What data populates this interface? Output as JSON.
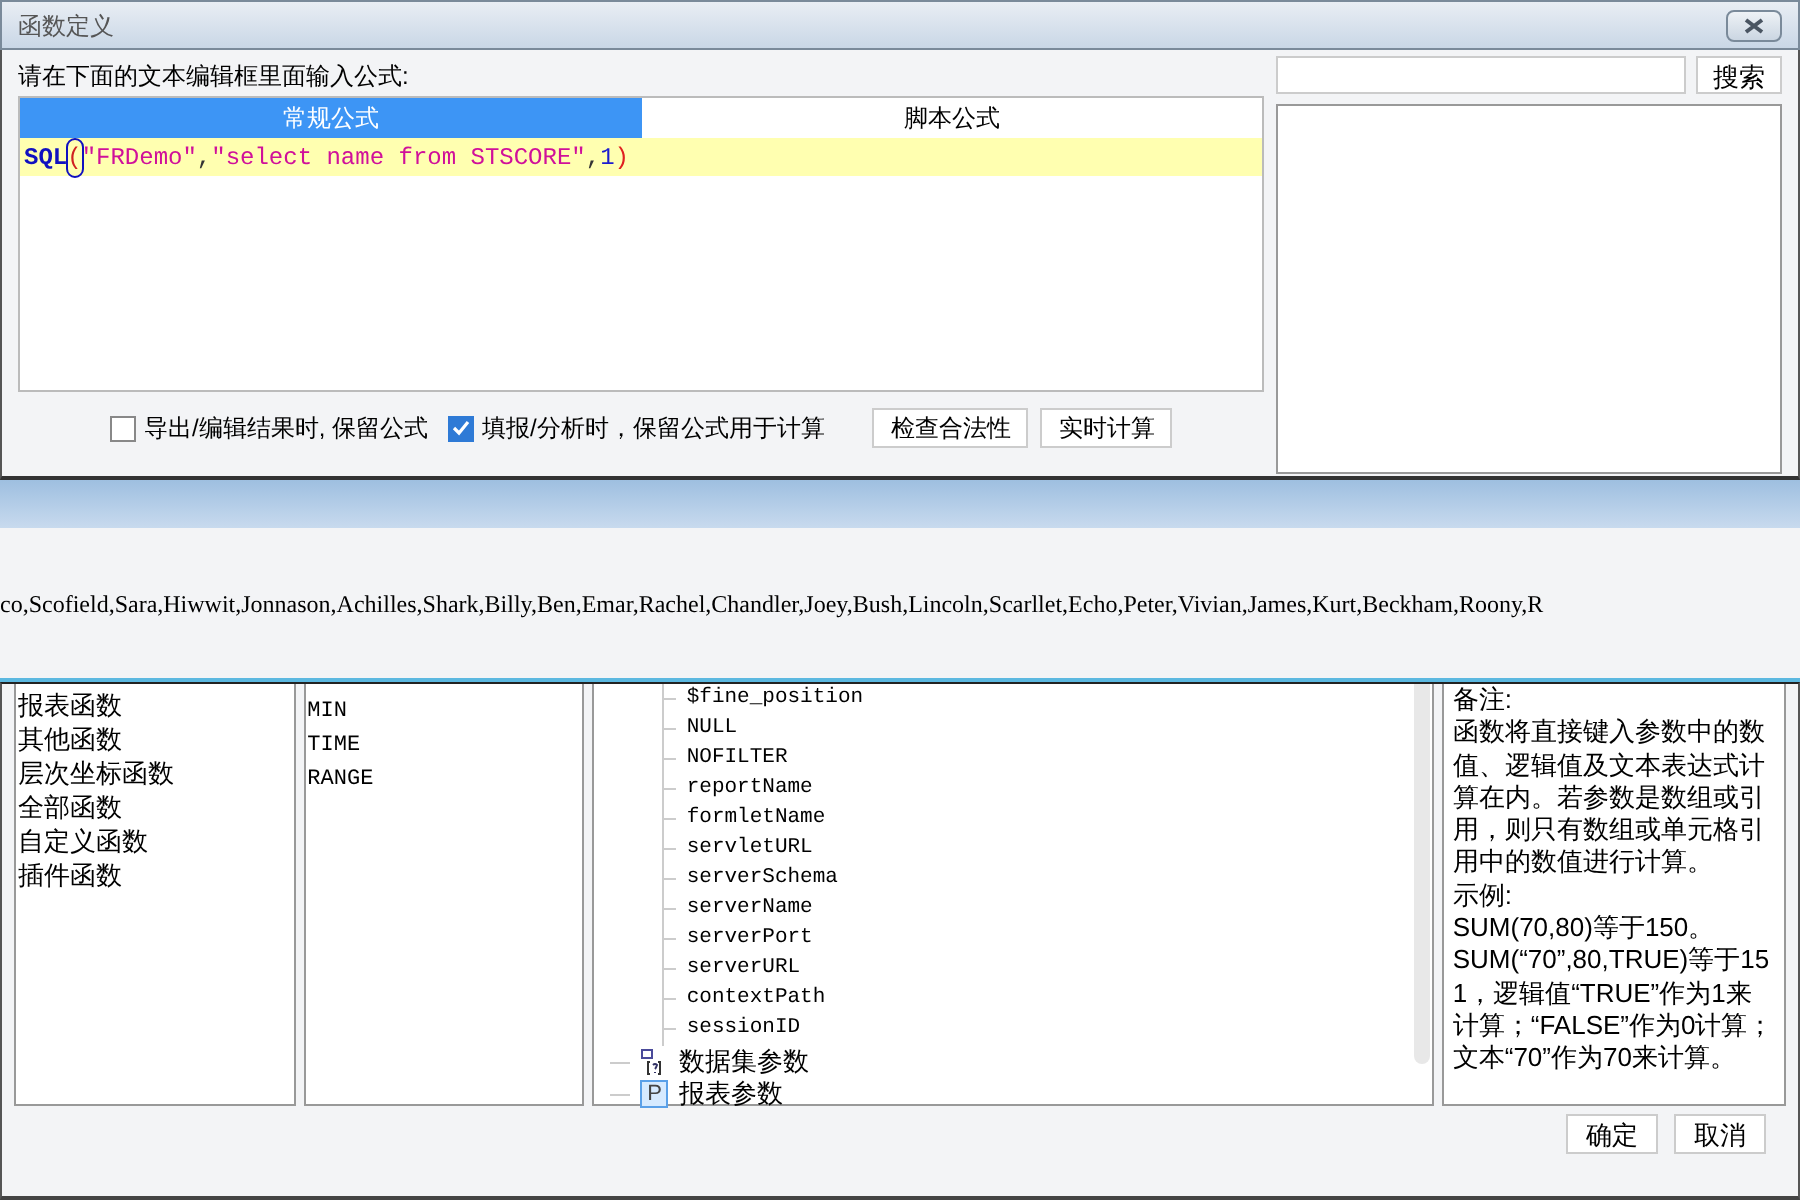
{
  "window": {
    "title": "函数定义"
  },
  "prompt": "请在下面的文本编辑框里面输入公式:",
  "search": {
    "button": "搜索"
  },
  "tabs": [
    {
      "label": "常规公式",
      "selected": true
    },
    {
      "label": "脚本公式",
      "selected": false
    }
  ],
  "formula": [
    {
      "kind": "function",
      "text": "SQL"
    },
    {
      "kind": "bracket",
      "text": "(",
      "highlighted": true
    },
    {
      "kind": "string",
      "text": "\"FRDemo\""
    },
    {
      "kind": "punct",
      "text": ","
    },
    {
      "kind": "string",
      "text": "\"select name from STSCORE\""
    },
    {
      "kind": "punct",
      "text": ","
    },
    {
      "kind": "number",
      "text": "1"
    },
    {
      "kind": "bracket",
      "text": ")",
      "highlighted": false
    }
  ],
  "options": [
    {
      "label": "导出/编辑结果时, 保留公式",
      "checked": false
    },
    {
      "label": "填报/分析时，保留公式用于计算",
      "checked": true
    }
  ],
  "actions": [
    "检查合法性",
    "实时计算"
  ],
  "result": "co,Scofield,Sara,Hiwwit,Jonnason,Achilles,Shark,Billy,Ben,Emar,Rachel,Chandler,Joey,Bush,Lincoln,Scarllet,Echo,Peter,Vivian,James,Kurt,Beckham,Roony,R",
  "categories": [
    "报表函数",
    "其他函数",
    "层次坐标函数",
    "全部函数",
    "自定义函数",
    "插件函数"
  ],
  "functions": [
    "MIN",
    "TIME",
    "RANGE"
  ],
  "tree": [
    {
      "kind": "group",
      "children": [
        {
          "label": "$fine_position"
        },
        {
          "label": "NULL"
        },
        {
          "label": "NOFILTER"
        },
        {
          "label": "reportName"
        },
        {
          "label": "formletName"
        },
        {
          "label": "servletURL"
        },
        {
          "label": "serverSchema"
        },
        {
          "label": "serverName"
        },
        {
          "label": "serverPort"
        },
        {
          "label": "serverURL"
        },
        {
          "label": "contextPath"
        },
        {
          "label": "sessionID"
        }
      ]
    },
    {
      "kind": "dataset",
      "label": "数据集参数"
    },
    {
      "kind": "param",
      "label": "报表参数",
      "icon_text": "P"
    }
  ],
  "note": [
    "备注:",
    "函数将直接键入参数中的数值、逻辑值及文本表达式计算在内。若参数是数组或引用，则只有数组或单元格引用中的数值进行计算。",
    "示例:",
    "SUM(70,80)等于150。",
    "SUM(“70”,80,TRUE)等于151，逻辑值“TRUE”作为1来计算；“FALSE”作为0计算；文本“70”作为70来计算。"
  ],
  "footer": [
    "确定",
    "取消"
  ]
}
